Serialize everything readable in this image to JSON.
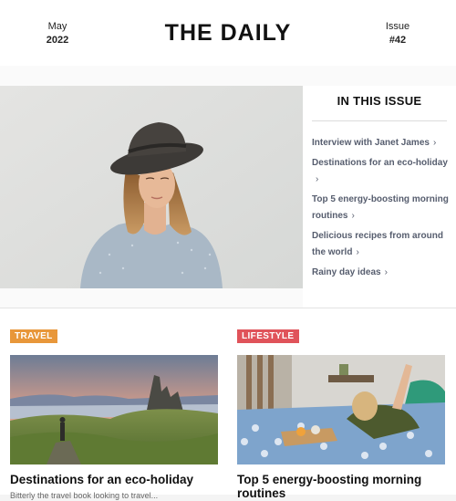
{
  "header": {
    "month": "May",
    "year": "2022",
    "title": "THE DAILY",
    "issue_label": "Issue",
    "issue_number": "#42"
  },
  "toc": {
    "title": "IN THIS ISSUE",
    "items": [
      "Interview with Janet James",
      "Destinations for an eco-holiday",
      "Top 5 energy-boosting morning routines",
      "Delicious recipes from around the world",
      "Rainy day ideas"
    ]
  },
  "articles": [
    {
      "tag": "TRAVEL",
      "title": "Destinations for an eco-holiday",
      "excerpt": "Bitterly the travel book looking to travel..."
    },
    {
      "tag": "LIFESTYLE",
      "title": "Top 5 energy-boosting morning routines",
      "excerpt": ""
    }
  ],
  "colors": {
    "travel_tag": "#e8973a",
    "lifestyle_tag": "#e0535a",
    "toc_link": "#565d6e"
  }
}
